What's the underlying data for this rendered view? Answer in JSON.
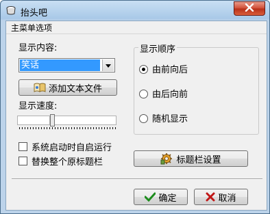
{
  "window": {
    "title": "抬头吧",
    "close_icon": "close-icon",
    "app_icon": "cup-icon"
  },
  "menubar": {
    "items": [
      "主菜单选项"
    ]
  },
  "display_content": {
    "label": "显示内容:",
    "selected": "笑话",
    "add_button": "添加文本文件",
    "add_button_icon": "book-icon"
  },
  "speed": {
    "label": "显示速度:"
  },
  "options": {
    "autostart": {
      "label": "系统启动时自启运行",
      "checked": false
    },
    "replace_title": {
      "label": "替换整个原标题栏",
      "checked": false
    }
  },
  "order": {
    "title": "显示顺序",
    "options": [
      {
        "label": "由前向后",
        "selected": true
      },
      {
        "label": "由后向前",
        "selected": false
      },
      {
        "label": "随机显示",
        "selected": false
      }
    ]
  },
  "titlebar_settings": {
    "label": "标题栏设置",
    "icon": "gear-icon"
  },
  "footer": {
    "ok": "确定",
    "cancel": "取消",
    "ok_icon": "check-icon",
    "cancel_icon": "x-icon"
  }
}
